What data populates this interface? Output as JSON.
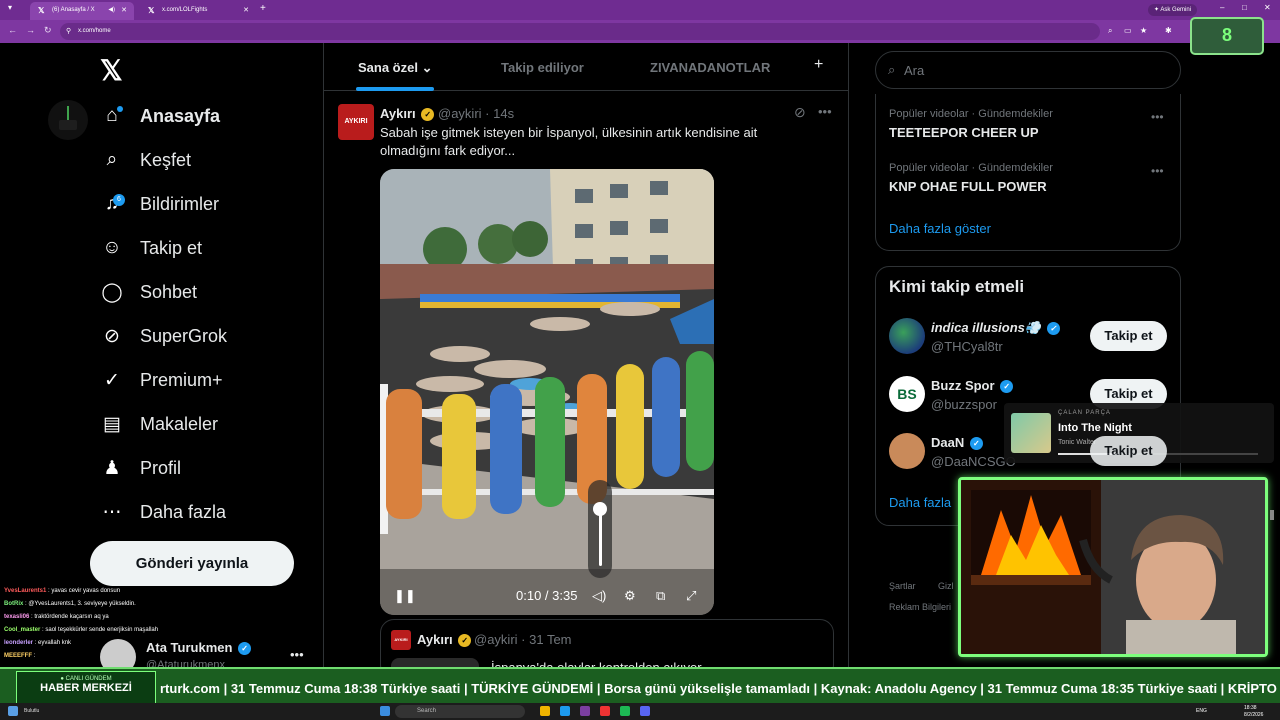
{
  "browser": {
    "tabs": [
      {
        "title": "(6) Anasayfa / X",
        "active": true
      },
      {
        "title": "x.com/LOLFights",
        "active": false
      }
    ],
    "url": "x.com/home",
    "ask_gemini": "Ask Gemini",
    "overlay_counter": "8"
  },
  "sidebar": {
    "items": [
      {
        "label": "Anasayfa",
        "icon": "home-icon",
        "glyph": "⌂"
      },
      {
        "label": "Keşfet",
        "icon": "search-icon",
        "glyph": "⌕"
      },
      {
        "label": "Bildirimler",
        "icon": "bell-icon",
        "glyph": "♫",
        "badge": "6"
      },
      {
        "label": "Takip et",
        "icon": "add-person-icon",
        "glyph": "☺"
      },
      {
        "label": "Sohbet",
        "icon": "chat-icon",
        "glyph": "◯"
      },
      {
        "label": "SuperGrok",
        "icon": "grok-icon",
        "glyph": "⊘"
      },
      {
        "label": "Premium+",
        "icon": "verified-icon",
        "glyph": "✓"
      },
      {
        "label": "Makaleler",
        "icon": "article-icon",
        "glyph": "▤"
      },
      {
        "label": "Profil",
        "icon": "person-icon",
        "glyph": "♟"
      },
      {
        "label": "Daha fazla",
        "icon": "more-circle-icon",
        "glyph": "⋯"
      }
    ],
    "post_button": "Gönderi yayınla",
    "account": {
      "name": "Ata Turukmen",
      "handle": "@Ataturukmenx"
    }
  },
  "stream_chat": [
    {
      "user": "YvesLaurents1",
      "msg": ": yavas cevir yavas donsun"
    },
    {
      "user": "BotRix",
      "msg": ": @YvesLaurents1, 3. seviyeye yükseldin."
    },
    {
      "user": "texasli06",
      "msg": ": traktördende kaçarsın aq ya"
    },
    {
      "user": "Cool_master",
      "msg": ": saol teşekkürler sende enerjiksin maşallah"
    },
    {
      "user": "leonderler",
      "msg": ": eyvallah knk"
    },
    {
      "user": "MEEEFFF",
      "msg": ":"
    }
  ],
  "feed": {
    "tabs": [
      "Sana özel",
      "Takip ediliyor",
      "ZIVANADANOTLAR"
    ],
    "tweet": {
      "avatar_text": "AYKIRI",
      "name": "Aykırı",
      "handle": "@aykiri",
      "time": "14s",
      "text": "Sabah işe gitmek isteyen bir İspanyol, ülkesinin artık kendisine ait olmadığını fark ediyor...",
      "video_time": "0:10 / 3:35",
      "volume_level": 0.75
    },
    "quote": {
      "name": "Aykırı",
      "handle": "@aykiri",
      "time": "31 Tem",
      "text": "İspanya'da olaylar kontrolden çıkıyor..."
    }
  },
  "right": {
    "search_placeholder": "Ara",
    "trends": [
      {
        "meta": "Popüler videolar · Gündemdekiler",
        "name": "TEETEEPOR CHEER UP"
      },
      {
        "meta": "Popüler videolar · Gündemdekiler",
        "name": "KNP OHAE FULL POWER"
      }
    ],
    "show_more": "Daha fazla göster",
    "who_to_follow_title": "Kimi takip etmeli",
    "who_to_follow": [
      {
        "name": "indica illusions💨",
        "handle": "@THCyal8tr",
        "button": "Takip et"
      },
      {
        "name": "Buzz Spor",
        "handle": "@buzzspor",
        "button": "Takip et"
      },
      {
        "name": "DaaN",
        "handle": "@DaaNCSGO",
        "button": "Takip et"
      }
    ],
    "show_more_2": "Daha fazla",
    "footer": [
      "Şartlar",
      "Gizl",
      "Reklam Bilgileri"
    ]
  },
  "now_playing": {
    "label": "ÇALAN PARÇA",
    "title": "Into The Night",
    "artist": "Tonic Walter",
    "progress": 0.3
  },
  "ticker": {
    "live_label": "● CANLI GÜNDEM",
    "brand": "HABER MERKEZİ",
    "text": "rturk.com | 31 Temmuz Cuma 18:38 Türkiye saati | TÜRKİYE GÜNDEMİ | Borsa günü yükselişle tamamladı | Kaynak: Anadolu Agency | 31 Temmuz Cuma 18:35 Türkiye saati | KRİPTO PİYASA | BTC ₺2.982.667 (24"
  },
  "taskbar": {
    "weather": "Bulutlu",
    "search": "Search",
    "lang": "ENG",
    "time": "18:38",
    "date": "8/2/2026"
  },
  "colors": {
    "accent": "#1d9bf0",
    "browser": "#6f2c91",
    "overlay_green": "#7dff7d"
  }
}
